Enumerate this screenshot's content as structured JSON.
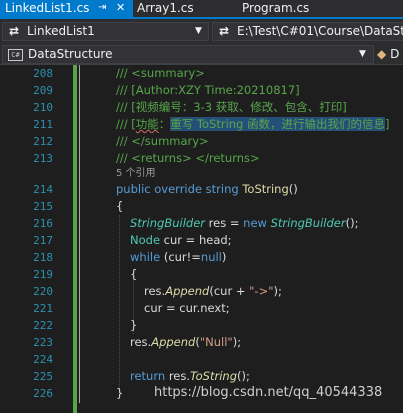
{
  "tabs": [
    {
      "label": "LinkedList1.cs",
      "active": true,
      "pin_icon": "pin-icon",
      "close_icon": "close-icon"
    },
    {
      "label": "Array1.cs",
      "active": false
    },
    {
      "label": "Program.cs",
      "active": false
    }
  ],
  "navbar": {
    "project_combo": "LinkedList1",
    "path_combo": "E:\\Test\\C#01\\Course\\DataStr"
  },
  "scopebar": {
    "namespace_badge": "C#",
    "namespace": "DataStructure",
    "member": "D"
  },
  "editor": {
    "line_numbers": [
      "208",
      "209",
      "210",
      "211",
      "212",
      "213",
      "214",
      "215",
      "216",
      "217",
      "218",
      "219",
      "220",
      "221",
      "222",
      "223",
      "224",
      "225",
      "226"
    ],
    "codelens": "5 个引用",
    "comments": {
      "l208": "/// <summary>",
      "l209": "/// [Author:XZY Time:20210817]",
      "l210": "/// [视频编号：3-3 获取、修改、包含、打印]",
      "l211_prefix": "/// [",
      "l211_squiggle": "功能",
      "l211_colon": "：",
      "l211_selected": "重写 ToString 函数，进行输出我们的信息",
      "l211_suffix": "]",
      "l212": "/// </summary>",
      "l213": "/// <returns> </returns>"
    },
    "code": {
      "l214_public": "public",
      "l214_override": "override",
      "l214_string": "string",
      "l214_method": "ToString",
      "l214_parens": "()",
      "l215": "{",
      "l216_type": "StringBuilder",
      "l216_var": " res = ",
      "l216_new": "new",
      "l216_ctor": "StringBuilder",
      "l216_end": "();",
      "l217_type": "Node",
      "l217_rest": " cur = head;",
      "l218_while": "while",
      "l218_cond": " (cur!=",
      "l218_null": "null",
      "l218_end": ")",
      "l219": "{",
      "l220_res": "res.",
      "l220_append": "Append",
      "l220_mid": "(cur + ",
      "l220_str": "\"->\"",
      "l220_end": ");",
      "l221": "cur = cur.next;",
      "l222": "}",
      "l223_res": "res.",
      "l223_append": "Append",
      "l223_open": "(",
      "l223_str": "\"Null\"",
      "l223_end": ");",
      "l225_return": "return",
      "l225_res": " res.",
      "l225_method": "ToString",
      "l225_end": "();",
      "l226": "}"
    }
  },
  "watermark": "https://blog.csdn.net/qq_40544338",
  "colors": {
    "accent": "#007acc",
    "editor_bg": "#1e1e1e",
    "comment": "#57a64a",
    "keyword": "#569cd6",
    "type": "#4ec9b0",
    "method": "#dcdcaa",
    "string": "#d69d85",
    "line_number": "#2b91af",
    "change_bar": "#57a64a"
  }
}
